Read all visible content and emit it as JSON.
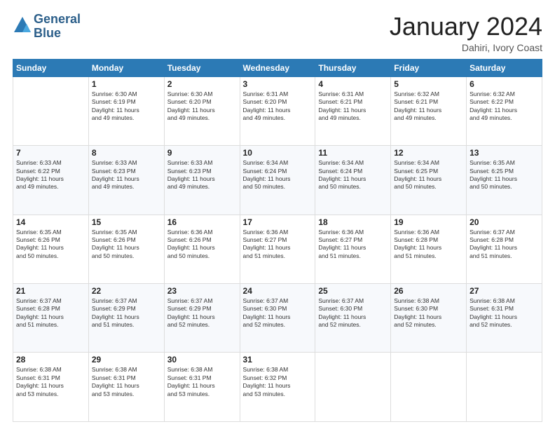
{
  "header": {
    "logo_line1": "General",
    "logo_line2": "Blue",
    "month": "January 2024",
    "location": "Dahiri, Ivory Coast"
  },
  "days_of_week": [
    "Sunday",
    "Monday",
    "Tuesday",
    "Wednesday",
    "Thursday",
    "Friday",
    "Saturday"
  ],
  "weeks": [
    [
      {
        "day": "",
        "sunrise": "",
        "sunset": "",
        "daylight": ""
      },
      {
        "day": "1",
        "sunrise": "Sunrise: 6:30 AM",
        "sunset": "Sunset: 6:19 PM",
        "daylight": "Daylight: 11 hours and 49 minutes."
      },
      {
        "day": "2",
        "sunrise": "Sunrise: 6:30 AM",
        "sunset": "Sunset: 6:20 PM",
        "daylight": "Daylight: 11 hours and 49 minutes."
      },
      {
        "day": "3",
        "sunrise": "Sunrise: 6:31 AM",
        "sunset": "Sunset: 6:20 PM",
        "daylight": "Daylight: 11 hours and 49 minutes."
      },
      {
        "day": "4",
        "sunrise": "Sunrise: 6:31 AM",
        "sunset": "Sunset: 6:21 PM",
        "daylight": "Daylight: 11 hours and 49 minutes."
      },
      {
        "day": "5",
        "sunrise": "Sunrise: 6:32 AM",
        "sunset": "Sunset: 6:21 PM",
        "daylight": "Daylight: 11 hours and 49 minutes."
      },
      {
        "day": "6",
        "sunrise": "Sunrise: 6:32 AM",
        "sunset": "Sunset: 6:22 PM",
        "daylight": "Daylight: 11 hours and 49 minutes."
      }
    ],
    [
      {
        "day": "7",
        "sunrise": "Sunrise: 6:33 AM",
        "sunset": "Sunset: 6:22 PM",
        "daylight": "Daylight: 11 hours and 49 minutes."
      },
      {
        "day": "8",
        "sunrise": "Sunrise: 6:33 AM",
        "sunset": "Sunset: 6:23 PM",
        "daylight": "Daylight: 11 hours and 49 minutes."
      },
      {
        "day": "9",
        "sunrise": "Sunrise: 6:33 AM",
        "sunset": "Sunset: 6:23 PM",
        "daylight": "Daylight: 11 hours and 49 minutes."
      },
      {
        "day": "10",
        "sunrise": "Sunrise: 6:34 AM",
        "sunset": "Sunset: 6:24 PM",
        "daylight": "Daylight: 11 hours and 50 minutes."
      },
      {
        "day": "11",
        "sunrise": "Sunrise: 6:34 AM",
        "sunset": "Sunset: 6:24 PM",
        "daylight": "Daylight: 11 hours and 50 minutes."
      },
      {
        "day": "12",
        "sunrise": "Sunrise: 6:34 AM",
        "sunset": "Sunset: 6:25 PM",
        "daylight": "Daylight: 11 hours and 50 minutes."
      },
      {
        "day": "13",
        "sunrise": "Sunrise: 6:35 AM",
        "sunset": "Sunset: 6:25 PM",
        "daylight": "Daylight: 11 hours and 50 minutes."
      }
    ],
    [
      {
        "day": "14",
        "sunrise": "Sunrise: 6:35 AM",
        "sunset": "Sunset: 6:26 PM",
        "daylight": "Daylight: 11 hours and 50 minutes."
      },
      {
        "day": "15",
        "sunrise": "Sunrise: 6:35 AM",
        "sunset": "Sunset: 6:26 PM",
        "daylight": "Daylight: 11 hours and 50 minutes."
      },
      {
        "day": "16",
        "sunrise": "Sunrise: 6:36 AM",
        "sunset": "Sunset: 6:26 PM",
        "daylight": "Daylight: 11 hours and 50 minutes."
      },
      {
        "day": "17",
        "sunrise": "Sunrise: 6:36 AM",
        "sunset": "Sunset: 6:27 PM",
        "daylight": "Daylight: 11 hours and 51 minutes."
      },
      {
        "day": "18",
        "sunrise": "Sunrise: 6:36 AM",
        "sunset": "Sunset: 6:27 PM",
        "daylight": "Daylight: 11 hours and 51 minutes."
      },
      {
        "day": "19",
        "sunrise": "Sunrise: 6:36 AM",
        "sunset": "Sunset: 6:28 PM",
        "daylight": "Daylight: 11 hours and 51 minutes."
      },
      {
        "day": "20",
        "sunrise": "Sunrise: 6:37 AM",
        "sunset": "Sunset: 6:28 PM",
        "daylight": "Daylight: 11 hours and 51 minutes."
      }
    ],
    [
      {
        "day": "21",
        "sunrise": "Sunrise: 6:37 AM",
        "sunset": "Sunset: 6:28 PM",
        "daylight": "Daylight: 11 hours and 51 minutes."
      },
      {
        "day": "22",
        "sunrise": "Sunrise: 6:37 AM",
        "sunset": "Sunset: 6:29 PM",
        "daylight": "Daylight: 11 hours and 51 minutes."
      },
      {
        "day": "23",
        "sunrise": "Sunrise: 6:37 AM",
        "sunset": "Sunset: 6:29 PM",
        "daylight": "Daylight: 11 hours and 52 minutes."
      },
      {
        "day": "24",
        "sunrise": "Sunrise: 6:37 AM",
        "sunset": "Sunset: 6:30 PM",
        "daylight": "Daylight: 11 hours and 52 minutes."
      },
      {
        "day": "25",
        "sunrise": "Sunrise: 6:37 AM",
        "sunset": "Sunset: 6:30 PM",
        "daylight": "Daylight: 11 hours and 52 minutes."
      },
      {
        "day": "26",
        "sunrise": "Sunrise: 6:38 AM",
        "sunset": "Sunset: 6:30 PM",
        "daylight": "Daylight: 11 hours and 52 minutes."
      },
      {
        "day": "27",
        "sunrise": "Sunrise: 6:38 AM",
        "sunset": "Sunset: 6:31 PM",
        "daylight": "Daylight: 11 hours and 52 minutes."
      }
    ],
    [
      {
        "day": "28",
        "sunrise": "Sunrise: 6:38 AM",
        "sunset": "Sunset: 6:31 PM",
        "daylight": "Daylight: 11 hours and 53 minutes."
      },
      {
        "day": "29",
        "sunrise": "Sunrise: 6:38 AM",
        "sunset": "Sunset: 6:31 PM",
        "daylight": "Daylight: 11 hours and 53 minutes."
      },
      {
        "day": "30",
        "sunrise": "Sunrise: 6:38 AM",
        "sunset": "Sunset: 6:31 PM",
        "daylight": "Daylight: 11 hours and 53 minutes."
      },
      {
        "day": "31",
        "sunrise": "Sunrise: 6:38 AM",
        "sunset": "Sunset: 6:32 PM",
        "daylight": "Daylight: 11 hours and 53 minutes."
      },
      {
        "day": "",
        "sunrise": "",
        "sunset": "",
        "daylight": ""
      },
      {
        "day": "",
        "sunrise": "",
        "sunset": "",
        "daylight": ""
      },
      {
        "day": "",
        "sunrise": "",
        "sunset": "",
        "daylight": ""
      }
    ]
  ]
}
